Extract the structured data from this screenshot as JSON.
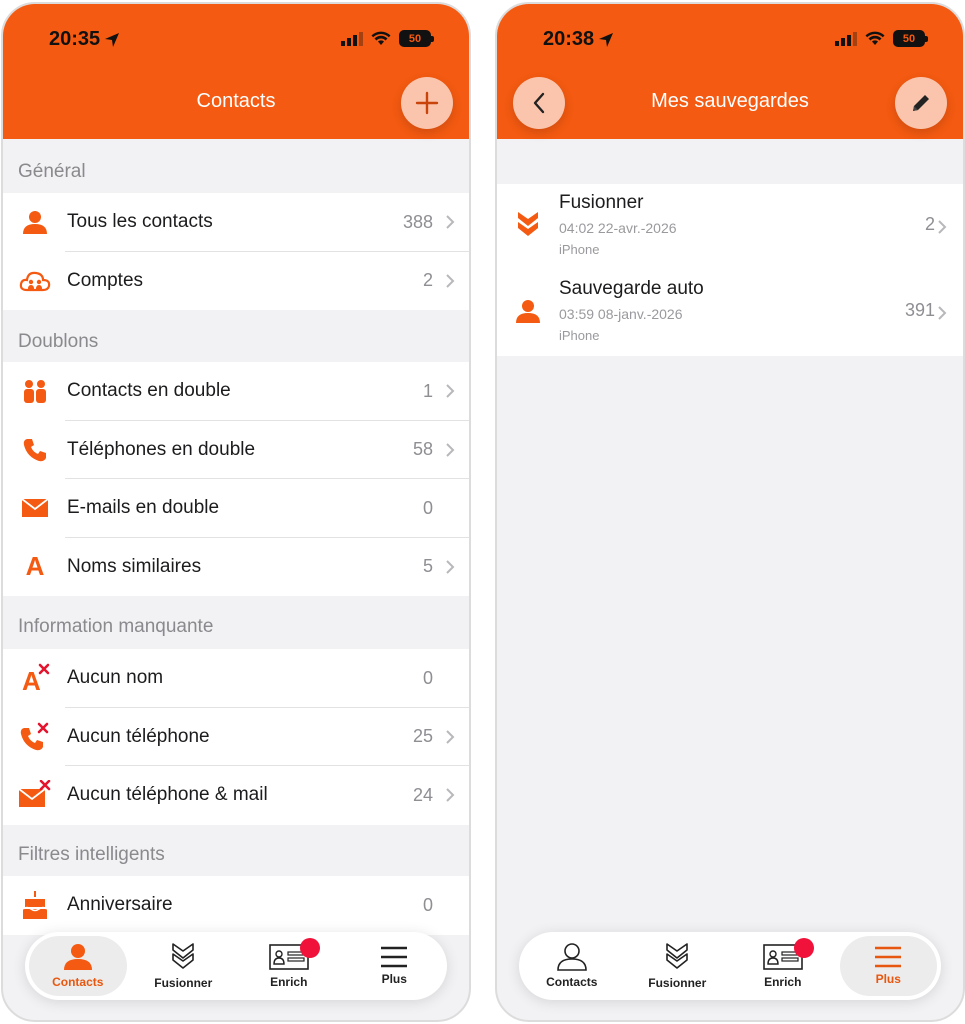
{
  "colors": {
    "accent": "#f45a11",
    "badge": "#f0123a",
    "header_button": "#fbc5ad"
  },
  "left": {
    "status": {
      "time": "20:35",
      "battery": "50"
    },
    "title": "Contacts",
    "add_button_icon": "plus-icon",
    "sections": [
      {
        "title": "Général",
        "rows": [
          {
            "icon": "person-icon",
            "label": "Tous les contacts",
            "count": "388",
            "chevron": true
          },
          {
            "icon": "cloud-accounts-icon",
            "label": "Comptes",
            "count": "2",
            "chevron": true
          }
        ]
      },
      {
        "title": "Doublons",
        "rows": [
          {
            "icon": "people-icon",
            "label": "Contacts en double",
            "count": "1",
            "chevron": true
          },
          {
            "icon": "phone-icon",
            "label": "Téléphones en double",
            "count": "58",
            "chevron": true
          },
          {
            "icon": "envelope-icon",
            "label": "E-mails en double",
            "count": "0",
            "chevron": false
          },
          {
            "icon": "letter-a-icon",
            "label": "Noms similaires",
            "count": "5",
            "chevron": true
          }
        ]
      },
      {
        "title": "Information manquante",
        "rows": [
          {
            "icon": "no-name-icon",
            "label": "Aucun nom",
            "count": "0",
            "chevron": false
          },
          {
            "icon": "no-phone-icon",
            "label": "Aucun téléphone",
            "count": "25",
            "chevron": true
          },
          {
            "icon": "no-phone-mail-icon",
            "label": "Aucun téléphone & mail",
            "count": "24",
            "chevron": true
          }
        ]
      },
      {
        "title": "Filtres intelligents",
        "rows": [
          {
            "icon": "birthday-cake-icon",
            "label": "Anniversaire",
            "count": "0",
            "chevron": false
          }
        ]
      }
    ],
    "tabs": [
      {
        "label": "Contacts",
        "icon": "person-tab-icon",
        "active": true,
        "badge": false
      },
      {
        "label": "Fusionner",
        "icon": "merge-tab-icon",
        "active": false,
        "badge": false
      },
      {
        "label": "Enrich",
        "icon": "id-card-tab-icon",
        "active": false,
        "badge": true
      },
      {
        "label": "Plus",
        "icon": "menu-tab-icon",
        "active": false,
        "badge": false
      }
    ]
  },
  "right": {
    "status": {
      "time": "20:38",
      "battery": "50"
    },
    "title": "Mes sauvegardes",
    "back_button_icon": "chevron-left-icon",
    "edit_button_icon": "pencil-icon",
    "backups": [
      {
        "icon": "merge-icon",
        "title": "Fusionner",
        "date": "04:02 22-avr.-2026",
        "device": "iPhone",
        "count": "2"
      },
      {
        "icon": "person-icon",
        "title": "Sauvegarde auto",
        "date": "03:59 08-janv.-2026",
        "device": "iPhone",
        "count": "391"
      }
    ],
    "tabs": [
      {
        "label": "Contacts",
        "icon": "person-tab-icon",
        "active": false,
        "badge": false
      },
      {
        "label": "Fusionner",
        "icon": "merge-tab-icon",
        "active": false,
        "badge": false
      },
      {
        "label": "Enrich",
        "icon": "id-card-tab-icon",
        "active": false,
        "badge": true
      },
      {
        "label": "Plus",
        "icon": "menu-tab-icon",
        "active": true,
        "badge": false
      }
    ]
  }
}
